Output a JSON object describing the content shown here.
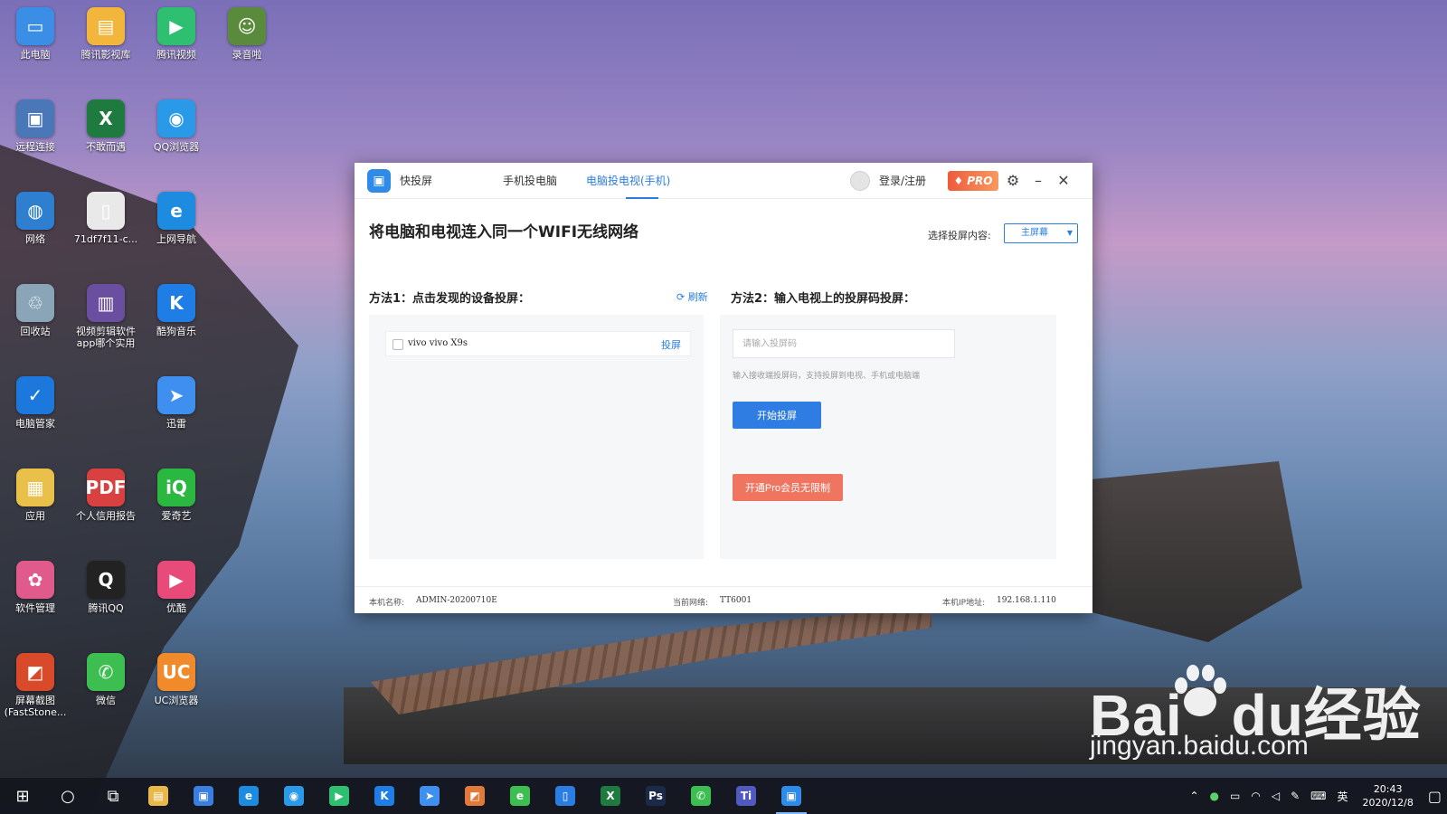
{
  "desktop": {
    "icons": [
      {
        "label": "此电脑",
        "glyph": "▭",
        "color": "#3a8ee6"
      },
      {
        "label": "腾讯影视库",
        "glyph": "▤",
        "color": "#f2b63c"
      },
      {
        "label": "腾讯视频",
        "glyph": "▶",
        "color": "#2fbf71"
      },
      {
        "label": "录音啦",
        "glyph": "☺",
        "color": "#5a8a3c"
      },
      {
        "label": "远程连接",
        "glyph": "▣",
        "color": "#4a77b8"
      },
      {
        "label": "不敢而遇",
        "glyph": "X",
        "color": "#1f7a40"
      },
      {
        "label": "QQ浏览器",
        "glyph": "◉",
        "color": "#2a9ae8"
      },
      {
        "label": "网络",
        "glyph": "◍",
        "color": "#2f7fd0"
      },
      {
        "label": "71df7f11-c...",
        "glyph": "▯",
        "color": "#e9e9e9"
      },
      {
        "label": "上网导航",
        "glyph": "e",
        "color": "#1d8be0"
      },
      {
        "label": "回收站",
        "glyph": "♲",
        "color": "#8aa4b8"
      },
      {
        "label": "视频剪辑软件app哪个实用",
        "glyph": "▥",
        "color": "#6a4ea0"
      },
      {
        "label": "酷狗音乐",
        "glyph": "K",
        "color": "#1e7ee6"
      },
      {
        "label": "电脑管家",
        "glyph": "✓",
        "color": "#1c78dc"
      },
      {
        "label": "迅雷",
        "glyph": "➤",
        "color": "#3f8ff0"
      },
      {
        "label": "应用",
        "glyph": "▦",
        "color": "#e8c04a"
      },
      {
        "label": "个人信用报告",
        "glyph": "PDF",
        "color": "#d94040"
      },
      {
        "label": "爱奇艺",
        "glyph": "iQ",
        "color": "#2ab840"
      },
      {
        "label": "软件管理",
        "glyph": "✿",
        "color": "#e05a8c"
      },
      {
        "label": "腾讯QQ",
        "glyph": "Q",
        "color": "#222222"
      },
      {
        "label": "优酷",
        "glyph": "▶",
        "color": "#e84a7a"
      },
      {
        "label": "屏幕截图(FastStone...",
        "glyph": "◩",
        "color": "#d84a2a"
      },
      {
        "label": "微信",
        "glyph": "✆",
        "color": "#3cbf50"
      },
      {
        "label": "UC浏览器",
        "glyph": "UC",
        "color": "#f08a2a"
      }
    ]
  },
  "app": {
    "name": "快投屏",
    "tabs": [
      "手机投电脑",
      "电脑投电视(手机)"
    ],
    "active_tab": 1,
    "login_label": "登录/注册",
    "pro_label": "PRO",
    "headline": "将电脑和电视连入同一个WIFI无线网络",
    "select_label": "选择投屏内容:",
    "select_value": "主屏幕",
    "method1": {
      "title": "方法1：点击发现的设备投屏：",
      "refresh_label": "刷新",
      "devices": [
        {
          "name": "vivo vivo X9s",
          "action": "投屏"
        }
      ]
    },
    "method2": {
      "title": "方法2：输入电视上的投屏码投屏：",
      "input_placeholder": "请输入投屏码",
      "hint": "输入接收端投屏码，支持投屏到电视、手机或电脑端",
      "start_label": "开始投屏",
      "vip_label": "开通Pro会员无限制"
    },
    "footer": {
      "host_label": "本机名称:",
      "host_value": "ADMIN-20200710E",
      "network_label": "当前网络:",
      "network_value": "TT6001",
      "ip_label": "本机IP地址:",
      "ip_value": "192.168.1.110"
    }
  },
  "taskbar": {
    "apps": [
      {
        "name": "file-explorer",
        "glyph": "▤",
        "color": "#e8b84a"
      },
      {
        "name": "store",
        "glyph": "▣",
        "color": "#3a7ee0"
      },
      {
        "name": "edge",
        "glyph": "e",
        "color": "#1d8be0"
      },
      {
        "name": "qq-browser",
        "glyph": "◉",
        "color": "#2a9ae8"
      },
      {
        "name": "tencent-video",
        "glyph": "▶",
        "color": "#2fbf71"
      },
      {
        "name": "kugou",
        "glyph": "K",
        "color": "#1e7ee6"
      },
      {
        "name": "xunlei",
        "glyph": "➤",
        "color": "#3f8ff0"
      },
      {
        "name": "screenshot",
        "glyph": "◩",
        "color": "#e07a3a"
      },
      {
        "name": "360-browser",
        "glyph": "e",
        "color": "#3cbf50"
      },
      {
        "name": "phone-app",
        "glyph": "▯",
        "color": "#2a7de1"
      },
      {
        "name": "excel",
        "glyph": "X",
        "color": "#1f7a40"
      },
      {
        "name": "photoshop",
        "glyph": "Ps",
        "color": "#1c2a4a"
      },
      {
        "name": "wechat",
        "glyph": "✆",
        "color": "#3cbf50"
      },
      {
        "name": "teams",
        "glyph": "Ti",
        "color": "#4e5ac0"
      },
      {
        "name": "kuaitouping",
        "glyph": "▣",
        "color": "#2f8be8"
      }
    ],
    "ime": "英",
    "time": "20:43",
    "date": "2020/12/8"
  },
  "watermark": {
    "brand_a": "Bai",
    "brand_b": "du",
    "brand_cn": "经验",
    "url": "jingyan.baidu.com"
  }
}
